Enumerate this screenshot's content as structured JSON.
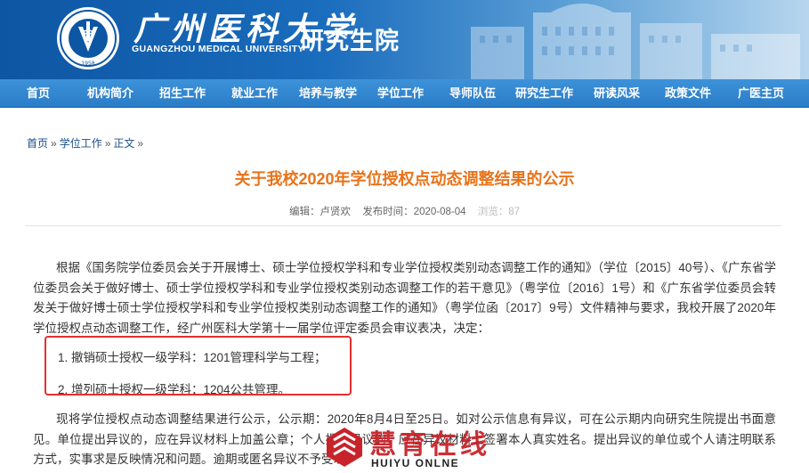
{
  "header": {
    "university_cn": "广州医科大学",
    "university_en": "GUANGZHOU MEDICAL UNIVERSITY",
    "school": "研究生院",
    "logo_year": "1958"
  },
  "nav": {
    "items": [
      "首页",
      "机构简介",
      "招生工作",
      "就业工作",
      "培养与教学",
      "学位工作",
      "导师队伍",
      "研究生工作",
      "研读风采",
      "政策文件",
      "广医主页"
    ]
  },
  "breadcrumb": {
    "home": "首页",
    "section": "学位工作",
    "current": "正文",
    "sep": "»"
  },
  "article": {
    "title": "关于我校2020年学位授权点动态调整结果的公示",
    "editor_label": "编辑：卢贤欢",
    "date_label": "发布时间：2020-08-04",
    "views_label": "浏览：87",
    "para1": "根据《国务院学位委员会关于开展博士、硕士学位授权学科和专业学位授权类别动态调整工作的通知》（学位〔2015〕40号）、《广东省学位委员会关于做好博士、硕士学位授权学科和专业学位授权类别动态调整工作的若干意见》（粤学位〔2016〕1号）和《广东省学位委员会转发关于做好博士硕士学位授权学科和专业学位授权类别动态调整工作的通知》（粤学位函〔2017〕9号）文件精神与要求，我校开展了2020年学位授权点动态调整工作，经广州医科大学第十一届学位评定委员会审议表决，决定：",
    "item1": "1. 撤销硕士授权一级学科：1201管理科学与工程；",
    "item2": "2. 增列硕士授权一级学科：1204公共管理。",
    "para2": "现将学位授权点动态调整结果进行公示，公示期：2020年8月4日至25日。如对公示信息有异议，可在公示期内向研究生院提出书面意见。单位提出异议的，应在异议材料上加盖公章；个人提出异议的，应在异议材料上签署本人真实姓名。提出异议的单位或个人请注明联系方式，实事求是反映情况和问题。逾期或匿名异议不予受理。"
  },
  "watermark": {
    "cn": "慧育在线",
    "en": "HUIYU ONLNE"
  },
  "colors": {
    "banner_blue": "#0d56a3",
    "nav_blue": "#2a7cc7",
    "title_orange": "#e8731a",
    "highlight_red": "#e3302e",
    "watermark_red": "#c8232a"
  }
}
